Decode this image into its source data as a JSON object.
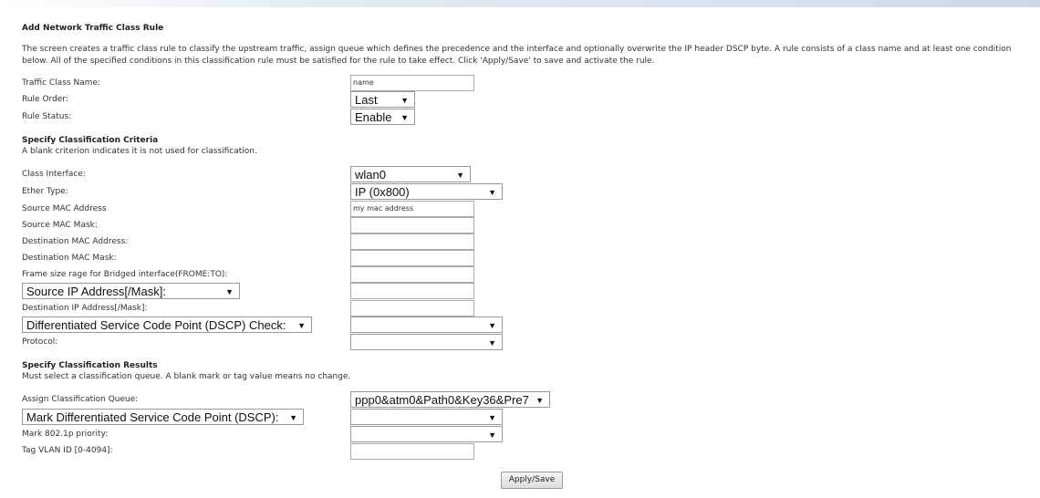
{
  "title": "Add Network Traffic Class Rule",
  "description": "The screen creates a traffic class rule to classify the upstream traffic, assign queue which defines the precedence and the interface and optionally overwrite the IP header DSCP byte. A rule consists of a class name and at least one condition below. All of the specified conditions in this classification rule must be satisfied for the rule to take effect. Click 'Apply/Save' to save and activate the rule.",
  "rule": {
    "name_label": "Traffic Class Name:",
    "name_value": "name",
    "order_label": "Rule Order:",
    "order_value": "Last",
    "status_label": "Rule Status:",
    "status_value": "Enable"
  },
  "criteria": {
    "heading": "Specify Classification Criteria",
    "note": "A blank criterion indicates it is not used for classification.",
    "class_interface_label": "Class Interface:",
    "class_interface_value": "wlan0",
    "ether_type_label": "Ether Type:",
    "ether_type_value": "IP (0x800)",
    "src_mac_label": "Source MAC Address",
    "src_mac_value": "my mac address",
    "src_mac_mask_label": "Source MAC Mask:",
    "dst_mac_label": "Destination MAC Address:",
    "dst_mac_mask_label": "Destination MAC Mask:",
    "frame_size_label": "Frame size rage for Bridged interface(FROME:TO):",
    "src_ip_select": "Source IP Address[/Mask]:",
    "dst_ip_label": "Destination IP Address[/Mask]:",
    "dscp_check_select": "Differentiated Service Code Point (DSCP) Check:",
    "protocol_label": "Protocol:"
  },
  "results": {
    "heading": "Specify Classification Results",
    "note": "Must select a classification queue. A blank mark or tag value means no change.",
    "queue_label": "Assign Classification Queue:",
    "queue_value": "ppp0&atm0&Path0&Key36&Pre7",
    "mark_dscp_select": "Mark Differentiated Service Code Point (DSCP):",
    "mark_8021p_label": "Mark 802.1p priority:",
    "vlan_label": "Tag VLAN ID [0-4094]:"
  },
  "apply_label": "Apply/Save"
}
